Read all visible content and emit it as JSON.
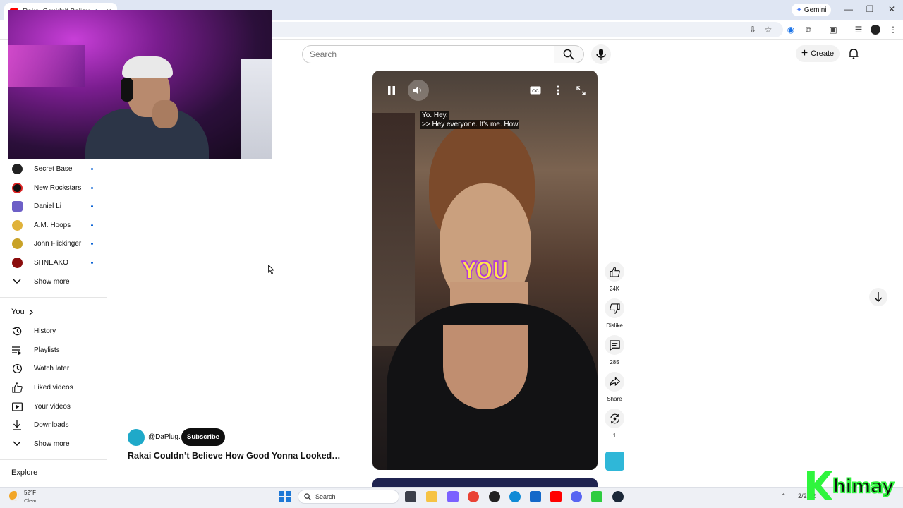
{
  "browser": {
    "tab_title": "Rakai Couldn't Believe How",
    "gemini_label": "Gemini"
  },
  "topbar": {
    "search_placeholder": "Search",
    "create_label": "Create"
  },
  "sidebar": {
    "subscriptions": [
      {
        "label": "Secret Base",
        "avatar_color": "#222222"
      },
      {
        "label": "New Rockstars",
        "avatar_color": "#111111"
      },
      {
        "label": "Daniel Li",
        "avatar_color": "#6d5fc7"
      },
      {
        "label": "A.M. Hoops",
        "avatar_color": "#e0b23a"
      },
      {
        "label": "John Flickinger",
        "avatar_color": "#c9a227"
      },
      {
        "label": "SHNEAKO",
        "avatar_color": "#8b0d0d"
      }
    ],
    "show_more_1": "Show more",
    "you_heading": "You",
    "you_items": [
      {
        "label": "History",
        "icon": "history-icon"
      },
      {
        "label": "Playlists",
        "icon": "playlists-icon"
      },
      {
        "label": "Watch later",
        "icon": "clock-icon"
      },
      {
        "label": "Liked videos",
        "icon": "thumbs-up-icon"
      },
      {
        "label": "Your videos",
        "icon": "play-square-icon"
      },
      {
        "label": "Downloads",
        "icon": "download-icon"
      }
    ],
    "show_more_2": "Show more",
    "explore_heading": "Explore"
  },
  "video": {
    "caption_line1": "Yo. Hey.",
    "caption_line2": ">> Hey everyone. It's me. How",
    "overlay_word": "YOU",
    "channel_handle": "@DaPlug.",
    "subscribe_label": "Subscribe",
    "title": "Rakai Couldn’t Believe How Good Yonna Looked…"
  },
  "actions": {
    "likes": "24K",
    "dislike_label": "Dislike",
    "comments": "285",
    "share_label": "Share",
    "remix_count": "1"
  },
  "taskbar": {
    "temperature": "52°F",
    "condition": "Clear",
    "search_label": "Search",
    "clock": "2/27/2"
  },
  "watermark": {
    "text": "himay"
  }
}
